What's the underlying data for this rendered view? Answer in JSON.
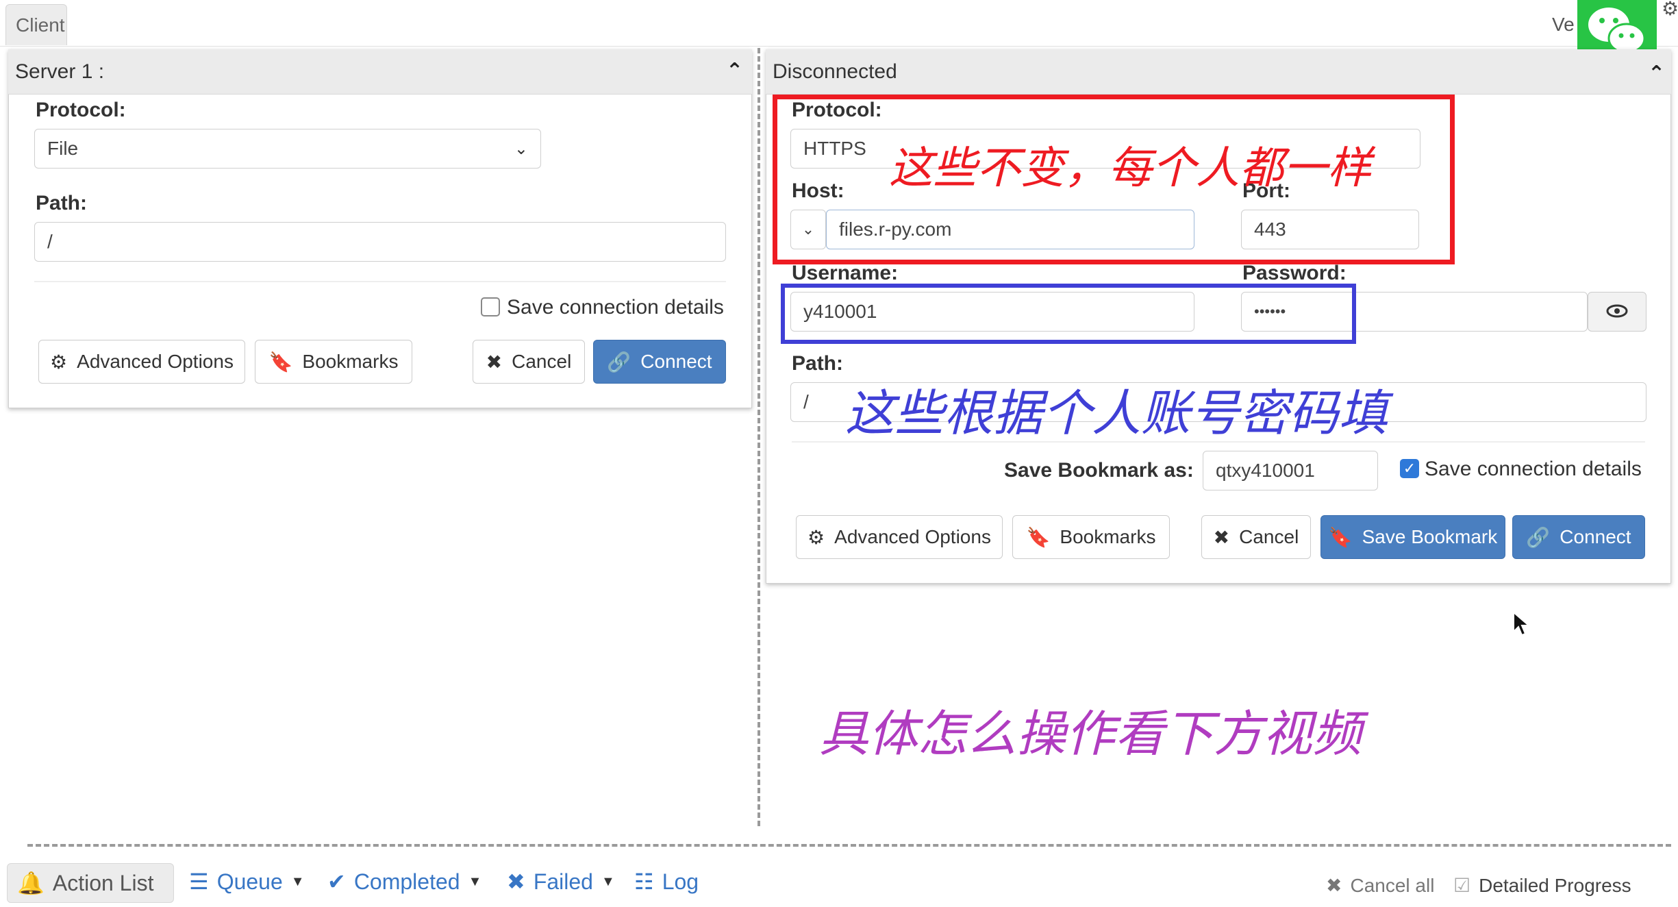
{
  "top": {
    "client_tab": "Client",
    "ver": "Ve"
  },
  "left_panel": {
    "title": "Server 1 :",
    "protocol_label": "Protocol:",
    "protocol_value": "File",
    "path_label": "Path:",
    "path_value": "/",
    "save_details_label": "Save connection details",
    "advanced_options": "Advanced Options",
    "bookmarks": "Bookmarks",
    "cancel": "Cancel",
    "connect": "Connect"
  },
  "right_panel": {
    "title": "Disconnected",
    "protocol_label": "Protocol:",
    "protocol_value": "HTTPS",
    "host_label": "Host:",
    "host_value": "files.r-py.com",
    "port_label": "Port:",
    "port_value": "443",
    "username_label": "Username:",
    "username_value": "y410001",
    "password_label": "Password:",
    "password_value": "••••••",
    "path_label": "Path:",
    "path_value": "/",
    "save_bookmark_label": "Save Bookmark as:",
    "save_bookmark_value": "qtxy410001",
    "save_details_label": "Save connection details",
    "advanced_options": "Advanced Options",
    "bookmarks": "Bookmarks",
    "cancel": "Cancel",
    "save_bookmark": "Save Bookmark",
    "connect": "Connect"
  },
  "annotations": {
    "red_text": "这些不变，每个人都一样",
    "blue_text": "这些根据个人账号密码填",
    "purple_text": "具体怎么操作看下方视频",
    "red_color": "#ee1b22",
    "blue_color": "#3f3fd6",
    "purple_color": "#b03cc0"
  },
  "bottom": {
    "action_list": "Action List",
    "queue": "Queue",
    "completed": "Completed",
    "failed": "Failed",
    "log": "Log",
    "cancel_all": "Cancel all",
    "detailed_progress": "Detailed Progress"
  },
  "icons": [
    "bell-icon",
    "list-icon",
    "check-icon",
    "x-icon",
    "log-icon",
    "gear-icon",
    "bookmark-icon",
    "link-icon",
    "eye-icon",
    "chevron-up-icon",
    "chevron-down-icon",
    "wechat-icon"
  ]
}
